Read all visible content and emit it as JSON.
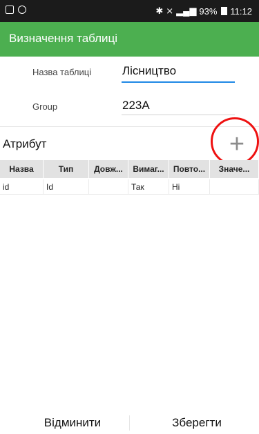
{
  "status_bar": {
    "battery": "93%",
    "time": "11:12"
  },
  "app_bar": {
    "title": "Визначення таблиці"
  },
  "form": {
    "table_name_label": "Назва таблиці",
    "table_name_value": "Лісництво",
    "group_label": "Group",
    "group_value": "223А"
  },
  "attributes": {
    "title": "Атрибут",
    "add_icon": "plus-icon",
    "columns": [
      "Назва",
      "Тип",
      "Довж...",
      "Вимаг...",
      "Повто...",
      "Значе..."
    ],
    "rows": [
      [
        "id",
        "Id",
        "",
        "Так",
        "Ні",
        ""
      ]
    ]
  },
  "bottom_bar": {
    "cancel_label": "Відминити",
    "save_label": "Зберегти"
  },
  "colors": {
    "app_bar": "#4caf50",
    "status_bar": "#1b1b1b",
    "highlight_circle": "#ee1111",
    "active_input": "#1e88e5"
  }
}
